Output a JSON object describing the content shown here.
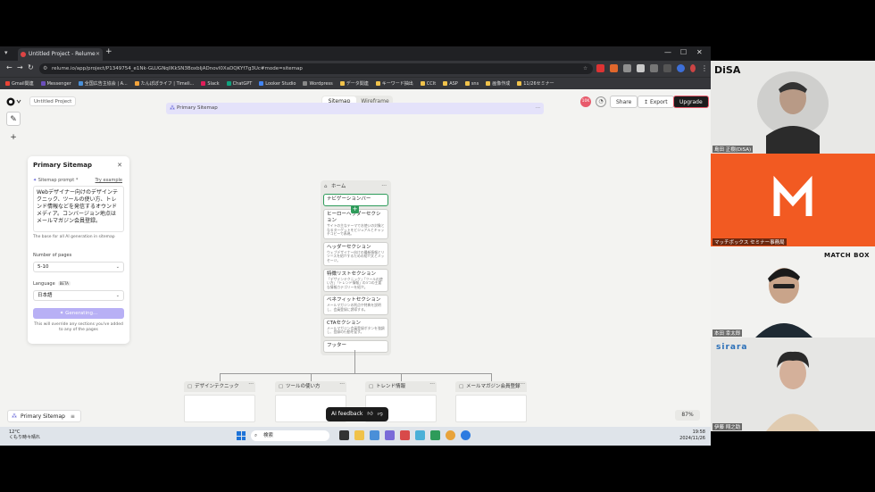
{
  "browser": {
    "tab_title": "Untitled Project - Relume",
    "url": "relume.io/app/project/P1349754_e1Nk-GLUGNqlIKkSN3BoxbIjADnovI0XaDQKYf7g3Uc#mode=sitemap",
    "bookmarks": [
      "Gmail関連",
      "Messenger",
      "全国広告主協会 | A...",
      "たんぽぽライフ | Timeli...",
      "Slack",
      "ChatGPT",
      "Looker Studio",
      "Wordpress",
      "データ関連",
      "キーワード抽出",
      "CCIt",
      "ASP",
      "sns",
      "画像作成",
      "11/26セミナー"
    ]
  },
  "app": {
    "project_name": "Untitled Project",
    "sitemap_bar_title": "Primary Sitemap",
    "view_tabs": [
      "Sitemap",
      "Wireframe"
    ],
    "avatar_initials": "10K",
    "share_label": "Share",
    "export_label": "Export",
    "upgrade_label": "Upgrade",
    "left_tools": [
      "ai-sparkle",
      "plus"
    ]
  },
  "panel": {
    "title": "Primary Sitemap",
    "prompt_label": "Sitemap prompt *",
    "try_example": "Try example",
    "prompt_text": "Webデザイナー向けのデザインテクニック、ツールの使い方、トレンド情報などを発信するオウンドメディア。コンバージョン地点はメールマガジン会員登録。",
    "prompt_help": "The base for all AI generation in sitemap",
    "pages_label": "Number of pages",
    "pages_value": "5-10",
    "language_label": "Language",
    "beta": "BETA",
    "language_value": "日本語",
    "generate_label": "Generating...",
    "generate_note": "This will override any sections you've added to any of the pages"
  },
  "home": {
    "title": "ホーム",
    "sections": [
      {
        "title": "ナビゲーションバー",
        "desc": ""
      },
      {
        "title": "ヒーローヘッダーセクション",
        "desc": "サイトの主なテーマでお使いの対象となるターゲットをビジュアルとキャッチコピーで表現。"
      },
      {
        "title": "ヘッダーセクション",
        "desc": "ウェブデザイナー向けの最新情報とリソースを紹介するための紹介文とメッセージ。"
      },
      {
        "title": "特徴リストセクション",
        "desc": "「デザインテクニック」「ツールの使い方」「トレンド情報」の3つの主要な情報カテゴリーを紹介。"
      },
      {
        "title": "ベネフィットセクション",
        "desc": "メールマガジンの利点や特典を説明し、会員登録に誘導する。"
      },
      {
        "title": "CTAセクション",
        "desc": "メールマガジン会員登録ボタンを強調し、登録の行動を促す。"
      },
      {
        "title": "フッター",
        "desc": ""
      }
    ]
  },
  "children": [
    "デザインテクニック",
    "ツールの使い方",
    "トレンド情報",
    "メールマガジン会員登録"
  ],
  "bottom": {
    "sitemap_label": "Primary Sitemap",
    "ai_feedback": "AI feedback",
    "zoom": "87%"
  },
  "taskbar": {
    "weather_temp": "12°C",
    "weather_desc": "くもり時々晴れ",
    "search_placeholder": "検索",
    "time": "19:58",
    "date": "2024/11/26"
  },
  "video": {
    "logo1": "DiSA",
    "name1": "島田 正樹(DiSA)",
    "name2": "マッチボックス セミナー事務局",
    "logo3": "MATCH BOX",
    "name3": "本田 幸太郎",
    "logo4": "sirara",
    "name4": "伊藤 翔之助"
  },
  "colors": {
    "accent": "#5b5bd6",
    "green": "#2e9b5a",
    "upgrade": "#1c1c1c",
    "matchbox_orange": "#f25a22"
  }
}
